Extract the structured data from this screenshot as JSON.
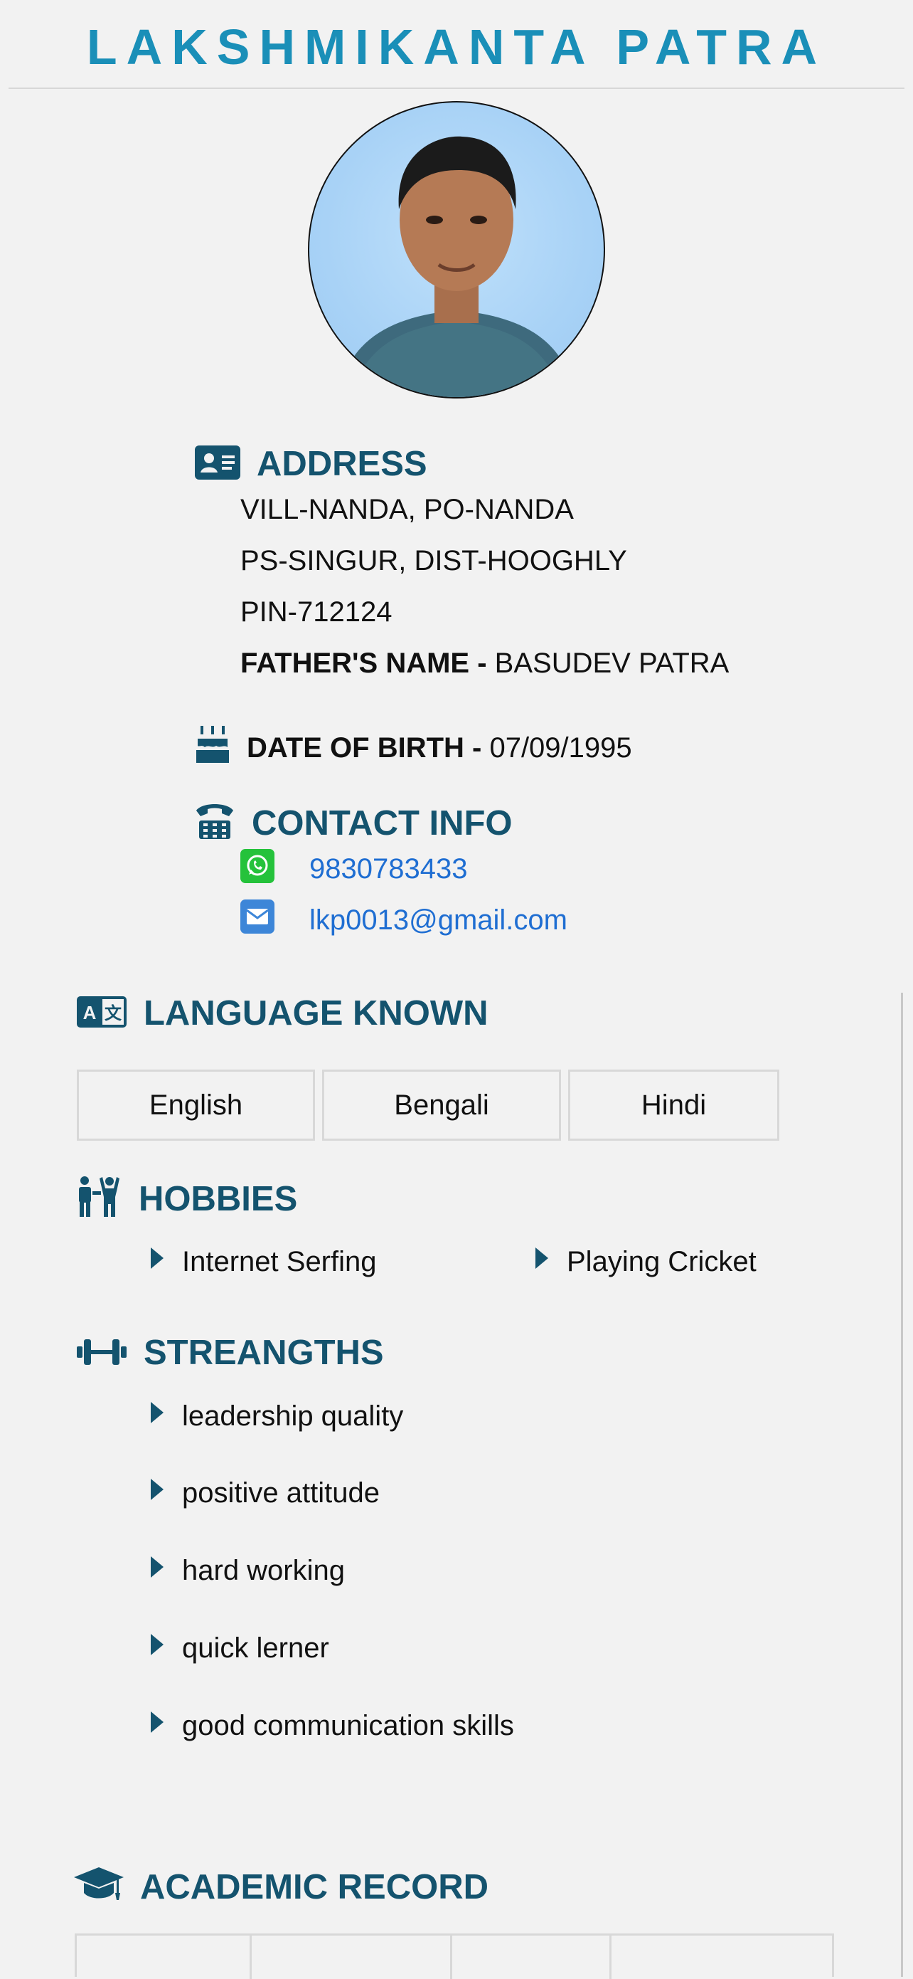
{
  "header": {
    "name": "LAKSHMIKANTA PATRA"
  },
  "photo": {
    "alt": "Profile photo of Lakshmikanta Patra"
  },
  "address": {
    "title": "ADDRESS",
    "lines": [
      "VILL-NANDA, PO-NANDA",
      "PS-SINGUR, DIST-HOOGHLY",
      "PIN-712124"
    ],
    "father_label": "FATHER'S NAME - ",
    "father_value": "BASUDEV PATRA"
  },
  "dob": {
    "label": "DATE OF BIRTH - ",
    "value": "07/09/1995"
  },
  "contact": {
    "title": "CONTACT INFO",
    "phone": "9830783433",
    "email": "lkp0013@gmail.com"
  },
  "languages": {
    "title": "LANGUAGE KNOWN",
    "items": [
      "English",
      "Bengali",
      "Hindi"
    ]
  },
  "hobbies": {
    "title": "HOBBIES",
    "items": [
      "Internet Serfing",
      "Playing Cricket"
    ]
  },
  "strengths": {
    "title": "STREANGTHS",
    "items": [
      "leadership quality",
      "positive attitude",
      "hard working",
      "quick lerner",
      "good communication skills"
    ]
  },
  "academic": {
    "title": "ACADEMIC RECORD"
  },
  "colors": {
    "title": "#1a8fb8",
    "heading": "#14536e",
    "link": "#1f6ed2",
    "whatsapp": "#25c23b",
    "mail": "#3d86d8",
    "background": "#f2f2f2"
  },
  "icons": [
    "id-card-icon",
    "birthday-cake-icon",
    "telephone-icon",
    "whatsapp-icon",
    "mail-icon",
    "language-icon",
    "hobbies-icon",
    "dumbbell-icon",
    "graduation-cap-icon"
  ]
}
